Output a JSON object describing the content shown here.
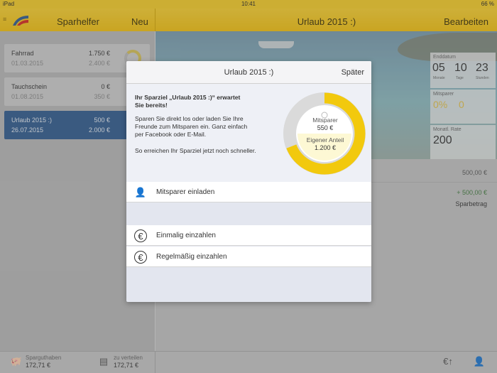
{
  "status": {
    "device": "iPad",
    "time": "10:41",
    "battery": "66 %"
  },
  "topbar": {
    "left_title": "Sparhelfer",
    "new_label": "Neu",
    "center_title": "Urlaub 2015 :)",
    "edit_label": "Bearbeiten"
  },
  "sidebar": {
    "accounts": [
      {
        "name": "Fahrrad",
        "date": "01.03.2015",
        "amount": "1.750 €",
        "target": "2.400 €"
      },
      {
        "name": "Tauchschein",
        "date": "01.08.2015",
        "amount": "0 €",
        "target": "350 €"
      },
      {
        "name": "Urlaub 2015 :)",
        "date": "26.07.2015",
        "amount": "500 €",
        "target": "2.000 €"
      }
    ]
  },
  "bottom": {
    "savings_label": "Sparguthaben",
    "savings_value": "172,71 €",
    "distribute_label": "zu verteilen",
    "distribute_value": "172,71 €"
  },
  "detail": {
    "enddatum_label": "Enddatum",
    "days": "05",
    "days_label": "Monate",
    "hours": "10",
    "hours_label": "Tage",
    "minutes": "23",
    "minutes_label": "Stunden",
    "mitsparer_label": "Mitsparer",
    "mitsparer_pct": "0%",
    "mitsparer_count": "0",
    "rate_label": "Monatl. Rate",
    "rate_value": "200",
    "row1_amount": "500,00 €",
    "row2_amount": "+ 500,00 €",
    "sparbetrag_label": "Sparbetrag"
  },
  "modal": {
    "title": "Urlaub 2015 :)",
    "later_label": "Später",
    "headline_1": "Ihr Sparziel „Urlaub 2015 :)“ erwartet",
    "headline_2": "Sie bereits!",
    "body_1": "Sparen Sie direkt los oder laden Sie Ihre",
    "body_2": "Freunde zum Mitsparen ein. Ganz einfach",
    "body_3": "per Facebook oder E-Mail.",
    "body_4": "So erreichen Ihr Sparziel jetzt noch schneller.",
    "donut": {
      "mitsparer_label": "Mitsparer",
      "mitsparer_value": "550 €",
      "own_label": "Eigener Anteil",
      "own_value": "1.200 €",
      "own_fraction": 0.69
    },
    "actions": {
      "invite": "Mitsparer einladen",
      "once": "Einmalig einzahlen",
      "regular": "Regelmäßig einzahlen"
    }
  },
  "colors": {
    "accent": "#f4c20d",
    "selected": "#2e5b8f",
    "donut_yellow": "#f2c90d"
  }
}
